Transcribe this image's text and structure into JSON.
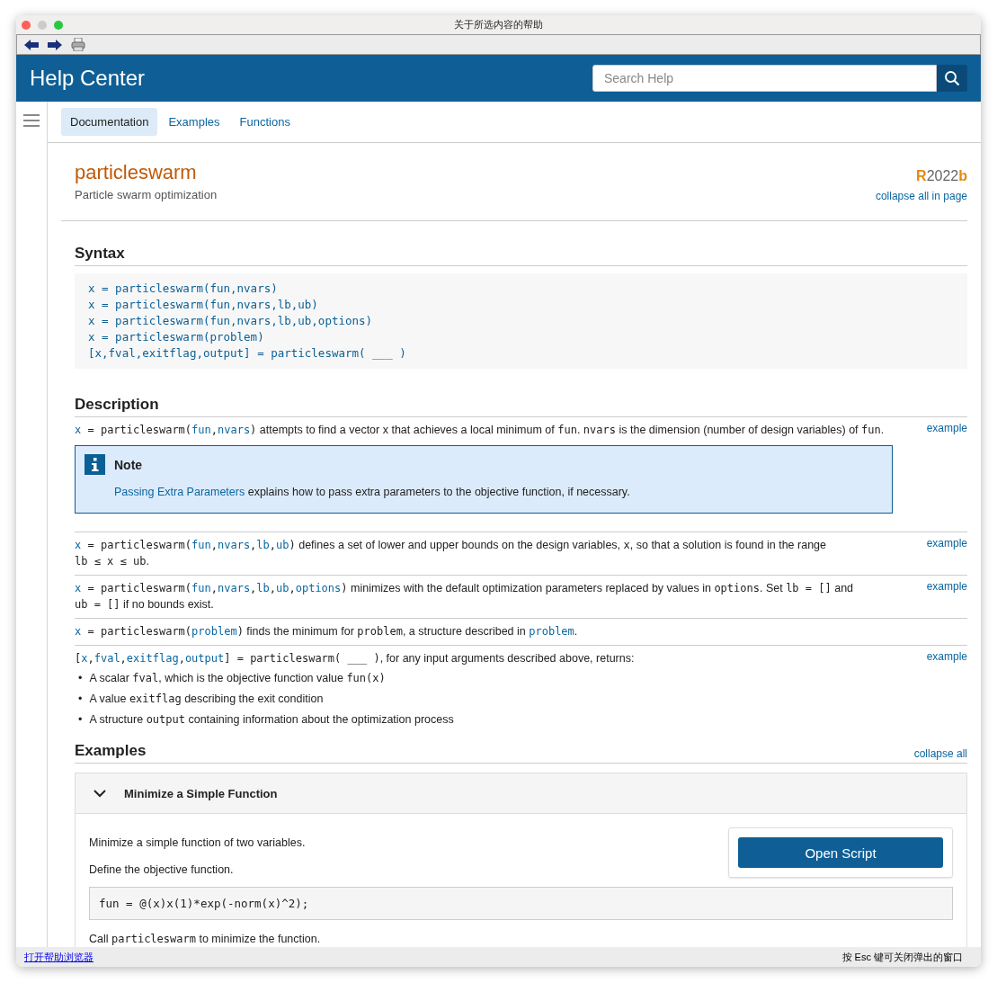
{
  "window": {
    "title": "关于所选内容的帮助"
  },
  "header": {
    "title": "Help Center",
    "search": {
      "placeholder": "Search Help"
    }
  },
  "tabs": [
    {
      "label": "Documentation",
      "selected": true
    },
    {
      "label": "Examples",
      "selected": false
    },
    {
      "label": "Functions",
      "selected": false
    }
  ],
  "page": {
    "title": "particleswarm",
    "subtitle": "Particle swarm optimization",
    "release": {
      "prefix": "R",
      "year": "2022",
      "suffix": "b"
    },
    "collapse_link": "collapse all in page"
  },
  "syntax": {
    "heading": "Syntax",
    "lines": [
      "x = particleswarm(fun,nvars)",
      "x = particleswarm(fun,nvars,lb,ub)",
      "x = particleswarm(fun,nvars,lb,ub,options)",
      "x = particleswarm(problem)",
      "[x,fval,exitflag,output] = particleswarm( ___ )"
    ]
  },
  "description": {
    "heading": "Description",
    "items": [
      {
        "example": "example",
        "segments": [
          {
            "kind": "var",
            "t": "x"
          },
          {
            "kind": "code",
            "t": " = particleswarm("
          },
          {
            "kind": "var",
            "t": "fun"
          },
          {
            "kind": "code",
            "t": ","
          },
          {
            "kind": "var",
            "t": "nvars"
          },
          {
            "kind": "code",
            "t": ")"
          },
          {
            "kind": "text",
            "t": " attempts to find a vector x that achieves a local minimum of "
          },
          {
            "kind": "code",
            "t": "fun"
          },
          {
            "kind": "text",
            "t": ". "
          },
          {
            "kind": "code",
            "t": "nvars"
          },
          {
            "kind": "text",
            "t": " is the dimension (number of design variables) of "
          },
          {
            "kind": "code",
            "t": "fun"
          },
          {
            "kind": "text",
            "t": "."
          }
        ],
        "note": {
          "title": "Note",
          "link": "Passing Extra Parameters",
          "text": " explains how to pass extra parameters to the objective function, if necessary."
        }
      },
      {
        "example": "example",
        "segments": [
          {
            "kind": "var",
            "t": "x"
          },
          {
            "kind": "code",
            "t": " = particleswarm("
          },
          {
            "kind": "var",
            "t": "fun"
          },
          {
            "kind": "code",
            "t": ","
          },
          {
            "kind": "var",
            "t": "nvars"
          },
          {
            "kind": "code",
            "t": ","
          },
          {
            "kind": "var",
            "t": "lb"
          },
          {
            "kind": "code",
            "t": ","
          },
          {
            "kind": "var",
            "t": "ub"
          },
          {
            "kind": "code",
            "t": ")"
          },
          {
            "kind": "text",
            "t": " defines a set of lower and upper bounds on the design variables, "
          },
          {
            "kind": "code",
            "t": "x"
          },
          {
            "kind": "text",
            "t": ", so that a solution is found in the range "
          },
          {
            "kind": "code",
            "t": "lb ≤ x ≤ ub"
          },
          {
            "kind": "text",
            "t": "."
          }
        ]
      },
      {
        "example": "example",
        "segments": [
          {
            "kind": "var",
            "t": "x"
          },
          {
            "kind": "code",
            "t": " = particleswarm("
          },
          {
            "kind": "var",
            "t": "fun"
          },
          {
            "kind": "code",
            "t": ","
          },
          {
            "kind": "var",
            "t": "nvars"
          },
          {
            "kind": "code",
            "t": ","
          },
          {
            "kind": "var",
            "t": "lb"
          },
          {
            "kind": "code",
            "t": ","
          },
          {
            "kind": "var",
            "t": "ub"
          },
          {
            "kind": "code",
            "t": ","
          },
          {
            "kind": "var",
            "t": "options"
          },
          {
            "kind": "code",
            "t": ")"
          },
          {
            "kind": "text",
            "t": " minimizes with the default optimization parameters replaced by values in "
          },
          {
            "kind": "code",
            "t": "options"
          },
          {
            "kind": "text",
            "t": ". Set "
          },
          {
            "kind": "code",
            "t": "lb = []"
          },
          {
            "kind": "text",
            "t": " and "
          },
          {
            "kind": "code",
            "t": "ub = []"
          },
          {
            "kind": "text",
            "t": " if no bounds exist."
          }
        ]
      },
      {
        "segments": [
          {
            "kind": "var",
            "t": "x"
          },
          {
            "kind": "code",
            "t": " = particleswarm("
          },
          {
            "kind": "var",
            "t": "problem"
          },
          {
            "kind": "code",
            "t": ")"
          },
          {
            "kind": "text",
            "t": " finds the minimum for "
          },
          {
            "kind": "code",
            "t": "problem"
          },
          {
            "kind": "text",
            "t": ", a structure described in "
          },
          {
            "kind": "var",
            "t": "problem"
          },
          {
            "kind": "text",
            "t": "."
          }
        ]
      },
      {
        "example": "example",
        "segments": [
          {
            "kind": "code",
            "t": "["
          },
          {
            "kind": "var",
            "t": "x"
          },
          {
            "kind": "code",
            "t": ","
          },
          {
            "kind": "var",
            "t": "fval"
          },
          {
            "kind": "code",
            "t": ","
          },
          {
            "kind": "var",
            "t": "exitflag"
          },
          {
            "kind": "code",
            "t": ","
          },
          {
            "kind": "var",
            "t": "output"
          },
          {
            "kind": "code",
            "t": "] = particleswarm( ___ )"
          },
          {
            "kind": "text",
            "t": ", for any input arguments described above, returns:"
          }
        ],
        "bullets": [
          {
            "marker": "•",
            "segments": [
              {
                "kind": "text",
                "t": "A scalar "
              },
              {
                "kind": "code",
                "t": "fval"
              },
              {
                "kind": "text",
                "t": ", which is the objective function value "
              },
              {
                "kind": "code",
                "t": "fun(x)"
              }
            ]
          },
          {
            "marker": "•",
            "segments": [
              {
                "kind": "text",
                "t": "A value "
              },
              {
                "kind": "code",
                "t": "exitflag"
              },
              {
                "kind": "text",
                "t": " describing the exit condition"
              }
            ]
          },
          {
            "marker": "•",
            "segments": [
              {
                "kind": "text",
                "t": "A structure "
              },
              {
                "kind": "code",
                "t": "output"
              },
              {
                "kind": "text",
                "t": " containing information about the optimization process"
              }
            ]
          }
        ]
      }
    ]
  },
  "examples": {
    "heading": "Examples",
    "collapse_link": "collapse all",
    "items": [
      {
        "title": "Minimize a Simple Function",
        "expanded": true,
        "paragraphs": [
          "Minimize a simple function of two variables.",
          "Define the objective function."
        ],
        "button": "Open Script",
        "code": "fun = @(x)x(1)*exp(-norm(x)^2);",
        "after": [
          {
            "kind": "text",
            "t": "Call "
          },
          {
            "kind": "code",
            "t": "particleswarm"
          },
          {
            "kind": "text",
            "t": " to minimize the function."
          }
        ]
      }
    ]
  },
  "footer": {
    "link": "打开帮助浏览器",
    "hint": "按 Esc 键可关闭弹出的窗口"
  }
}
